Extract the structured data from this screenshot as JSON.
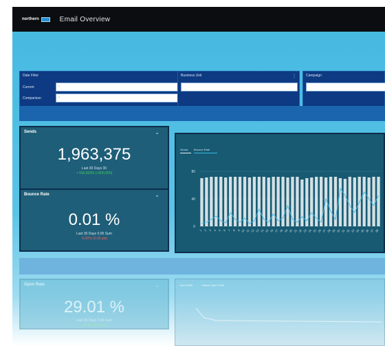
{
  "header": {
    "logo_text": "northern",
    "app_title": "Email Overview"
  },
  "filters": {
    "date": {
      "label": "Date Filter",
      "rows": [
        {
          "label": "Current",
          "value": ""
        },
        {
          "label": "Comparison",
          "value": ""
        }
      ]
    },
    "business_unit": {
      "label": "Business Unit",
      "value": ""
    },
    "campaign": {
      "label": "Campaign",
      "value": ""
    }
  },
  "kpis": [
    {
      "title": "Sends",
      "value": "1,963,375",
      "sub": "Last 30 Days 30",
      "delta": "+ 000,000% (+000,000)",
      "delta_color": "#39d353"
    },
    {
      "title": "Bounce Rate",
      "value": "0.01 %",
      "sub": "Last 30 Days 0.00 Sum",
      "delta": "-0.00% (0.00 pts)",
      "delta_color": "#ff5a5a"
    },
    {
      "title": "Open Rate",
      "value": "29.01 %",
      "sub": "Last 30 Days 0.00 Sum",
      "delta": "+0.00 (0.00 pts)",
      "delta_color": "#7be07b"
    }
  ],
  "chart": {
    "legend": [
      "Sends",
      "Bounce Rate"
    ],
    "colors": {
      "bars": "#e8f0f2",
      "line": "#3fb8e6",
      "text": "#cfe3ee"
    }
  },
  "chart2": {
    "legend": [
      "Open Rate",
      "Unique Open Rate"
    ]
  },
  "chart_data": {
    "type": "bar",
    "title": "",
    "xlabel": "",
    "ylabel": "",
    "y_tick_labels": [
      "80",
      "40",
      "0"
    ],
    "categories": [
      "1",
      "2",
      "3",
      "4",
      "5",
      "6",
      "7",
      "8",
      "9",
      "10",
      "11",
      "12",
      "13",
      "14",
      "15",
      "16",
      "17",
      "18",
      "19",
      "20",
      "21",
      "22",
      "23",
      "24",
      "25",
      "26",
      "27",
      "28",
      "29",
      "30",
      "31",
      "32",
      "33",
      "34",
      "35",
      "36",
      "37",
      "38"
    ],
    "series": [
      {
        "name": "Sends",
        "values": [
          70,
          71,
          72,
          72,
          72,
          71,
          72,
          72,
          72,
          72,
          71,
          72,
          72,
          72,
          71,
          72,
          72,
          72,
          71,
          72,
          72,
          68,
          70,
          71,
          72,
          72,
          71,
          72,
          72,
          70,
          69,
          72,
          71,
          72,
          72,
          71,
          72,
          72
        ]
      },
      {
        "name": "Bounce Rate",
        "values": [
          4,
          6,
          10,
          15,
          8,
          5,
          20,
          10,
          6,
          12,
          4,
          8,
          25,
          10,
          6,
          18,
          8,
          12,
          30,
          10,
          6,
          14,
          8,
          20,
          12,
          6,
          40,
          22,
          10,
          55,
          45,
          30,
          20,
          35,
          50,
          40,
          30,
          45
        ]
      }
    ],
    "ylim": [
      0,
      90
    ],
    "grid": true,
    "legend_position": "top-left"
  }
}
